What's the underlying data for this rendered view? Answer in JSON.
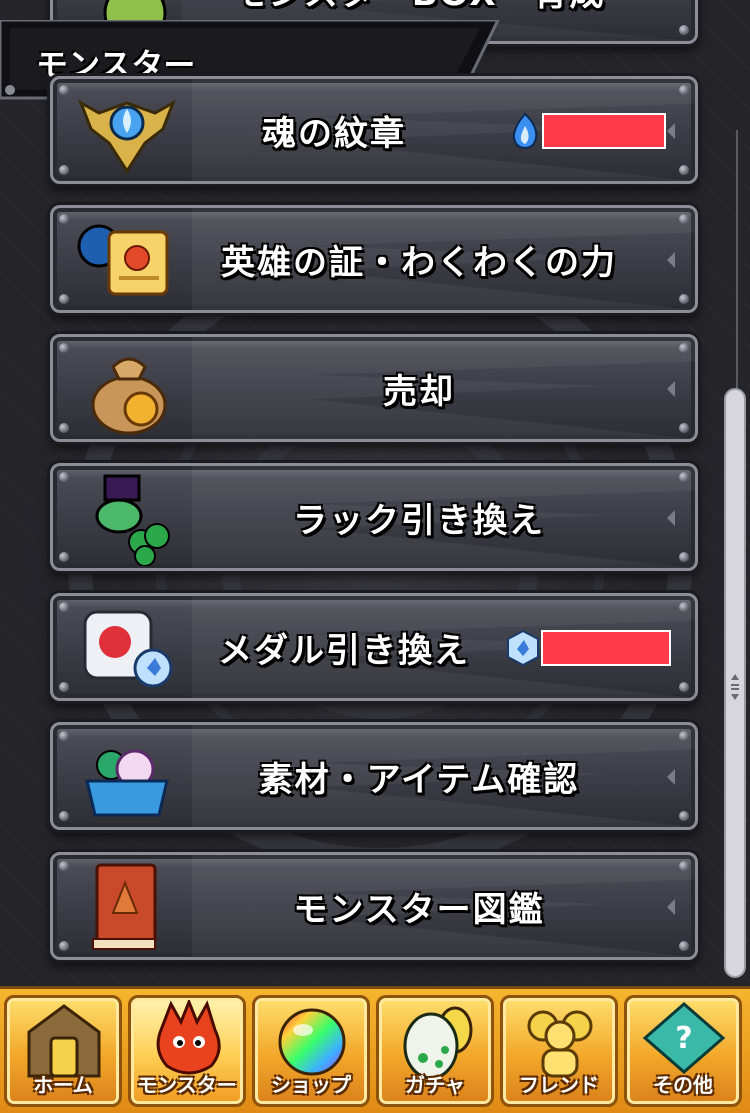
{
  "header": {
    "title": "モンスター"
  },
  "menu": [
    {
      "label": "モンスターBOX・育成",
      "icon": "monster-box-icon"
    },
    {
      "label": "魂の紋章",
      "icon": "soul-crest-icon",
      "counter_icon": "blue-flame-icon"
    },
    {
      "label": "英雄の証・わくわくの力",
      "icon": "hero-scroll-icon"
    },
    {
      "label": "売却",
      "icon": "money-bag-icon"
    },
    {
      "label": "ラック引き換え",
      "icon": "clover-frog-icon"
    },
    {
      "label": "メダル引き換え",
      "icon": "medal-card-icon",
      "counter_icon": "medal-icon"
    },
    {
      "label": "素材・アイテム確認",
      "icon": "item-basket-icon"
    },
    {
      "label": "モンスター図鑑",
      "icon": "encyclopedia-book-icon"
    }
  ],
  "nav": [
    {
      "label": "ホーム",
      "icon": "home-gate-icon"
    },
    {
      "label": "モンスター",
      "icon": "red-dragon-icon"
    },
    {
      "label": "ショップ",
      "icon": "rainbow-orb-icon"
    },
    {
      "label": "ガチャ",
      "icon": "egg-icon"
    },
    {
      "label": "フレンド",
      "icon": "friends-icon"
    },
    {
      "label": "その他",
      "icon": "other-sign-icon"
    }
  ],
  "colors": {
    "accent": "#f2a72a",
    "redacted": "#ff3b4a",
    "panel": "#3a3a43"
  }
}
